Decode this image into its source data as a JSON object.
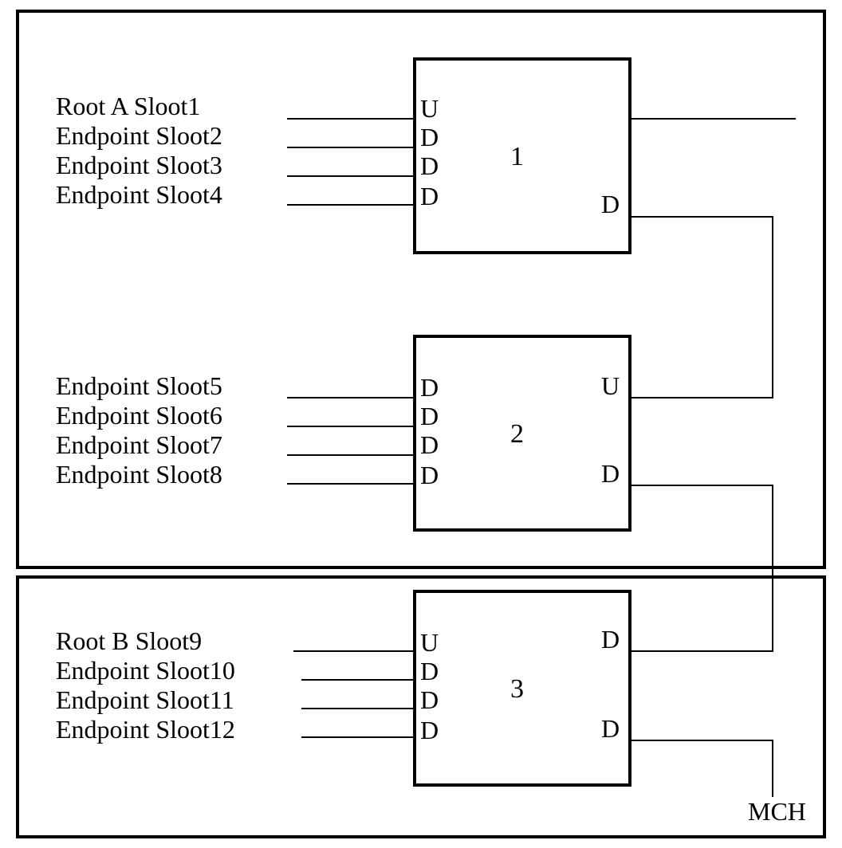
{
  "blocks": [
    {
      "number": "1",
      "slots": [
        {
          "label": "Root A Sloot1",
          "port": "U"
        },
        {
          "label": "Endpoint Sloot2",
          "port": "D"
        },
        {
          "label": "Endpoint Sloot3",
          "port": "D"
        },
        {
          "label": "Endpoint Sloot4",
          "port": "D"
        }
      ],
      "right_ports": [
        {
          "port": "D"
        }
      ]
    },
    {
      "number": "2",
      "slots": [
        {
          "label": "Endpoint Sloot5",
          "port": "D"
        },
        {
          "label": "Endpoint Sloot6",
          "port": "D"
        },
        {
          "label": "Endpoint Sloot7",
          "port": "D"
        },
        {
          "label": "Endpoint Sloot8",
          "port": "D"
        }
      ],
      "right_ports": [
        {
          "port": "U"
        },
        {
          "port": "D"
        }
      ]
    },
    {
      "number": "3",
      "slots": [
        {
          "label": "Root B Sloot9",
          "port": "U"
        },
        {
          "label": "Endpoint Sloot10",
          "port": "D"
        },
        {
          "label": "Endpoint Sloot11",
          "port": "D"
        },
        {
          "label": "Endpoint Sloot12",
          "port": "D"
        }
      ],
      "right_ports": [
        {
          "port": "D"
        },
        {
          "port": "D"
        }
      ]
    }
  ],
  "mch_label": "MCH"
}
